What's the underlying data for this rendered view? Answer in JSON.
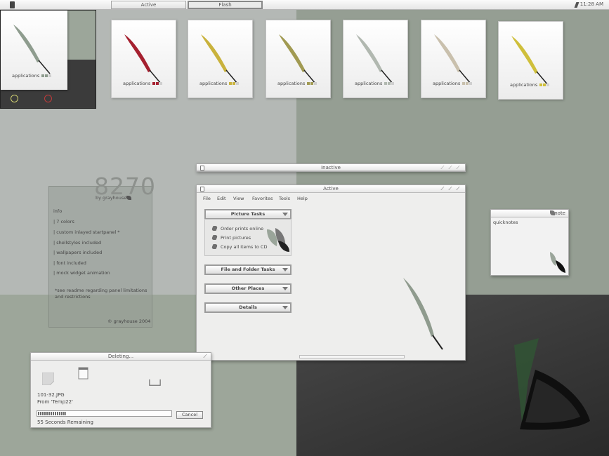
{
  "taskbar": {
    "tasks": [
      {
        "label": "Active"
      },
      {
        "label": "Flash"
      }
    ],
    "clock": "11:28 AM"
  },
  "thumbnails": {
    "label": "applications",
    "colors": [
      "#a5202f",
      "#c9b23c",
      "#a19a52",
      "#b1b8b0",
      "#c9c0ad",
      "#cfbf3b"
    ],
    "preview_color": "#8e9c8e"
  },
  "info": {
    "title": "8270",
    "byline": "by grayhouse",
    "heading": "info",
    "items": [
      "| 7 colors",
      "| custom inlayed startpanel *",
      "| shellstyles included",
      "| wallpapers included",
      "| font included",
      "| mock widget animation"
    ],
    "note": "*see readme regarding panel limitations and restrictions",
    "copyright": "© grayhouse 2004"
  },
  "inactive_window": {
    "title": "Inactive"
  },
  "active_window": {
    "title": "Active",
    "menu": [
      "File",
      "Edit",
      "View",
      "Favorites",
      "Tools",
      "Help"
    ],
    "tasks": {
      "picture": {
        "title": "Picture Tasks",
        "items": [
          "Order prints online",
          "Print pictures",
          "Copy all items to CD"
        ]
      },
      "file_folder": "File and Folder Tasks",
      "other_places": "Other Places",
      "details": "Details"
    }
  },
  "delete_dialog": {
    "title": "Deleting...",
    "filename": "101-32.JPG",
    "from": "From 'Temp22'",
    "remaining": "55 Seconds Remaining",
    "cancel": "Cancel",
    "progress": 0.21
  },
  "note_widget": {
    "title": "note",
    "content": "quicknotes"
  }
}
